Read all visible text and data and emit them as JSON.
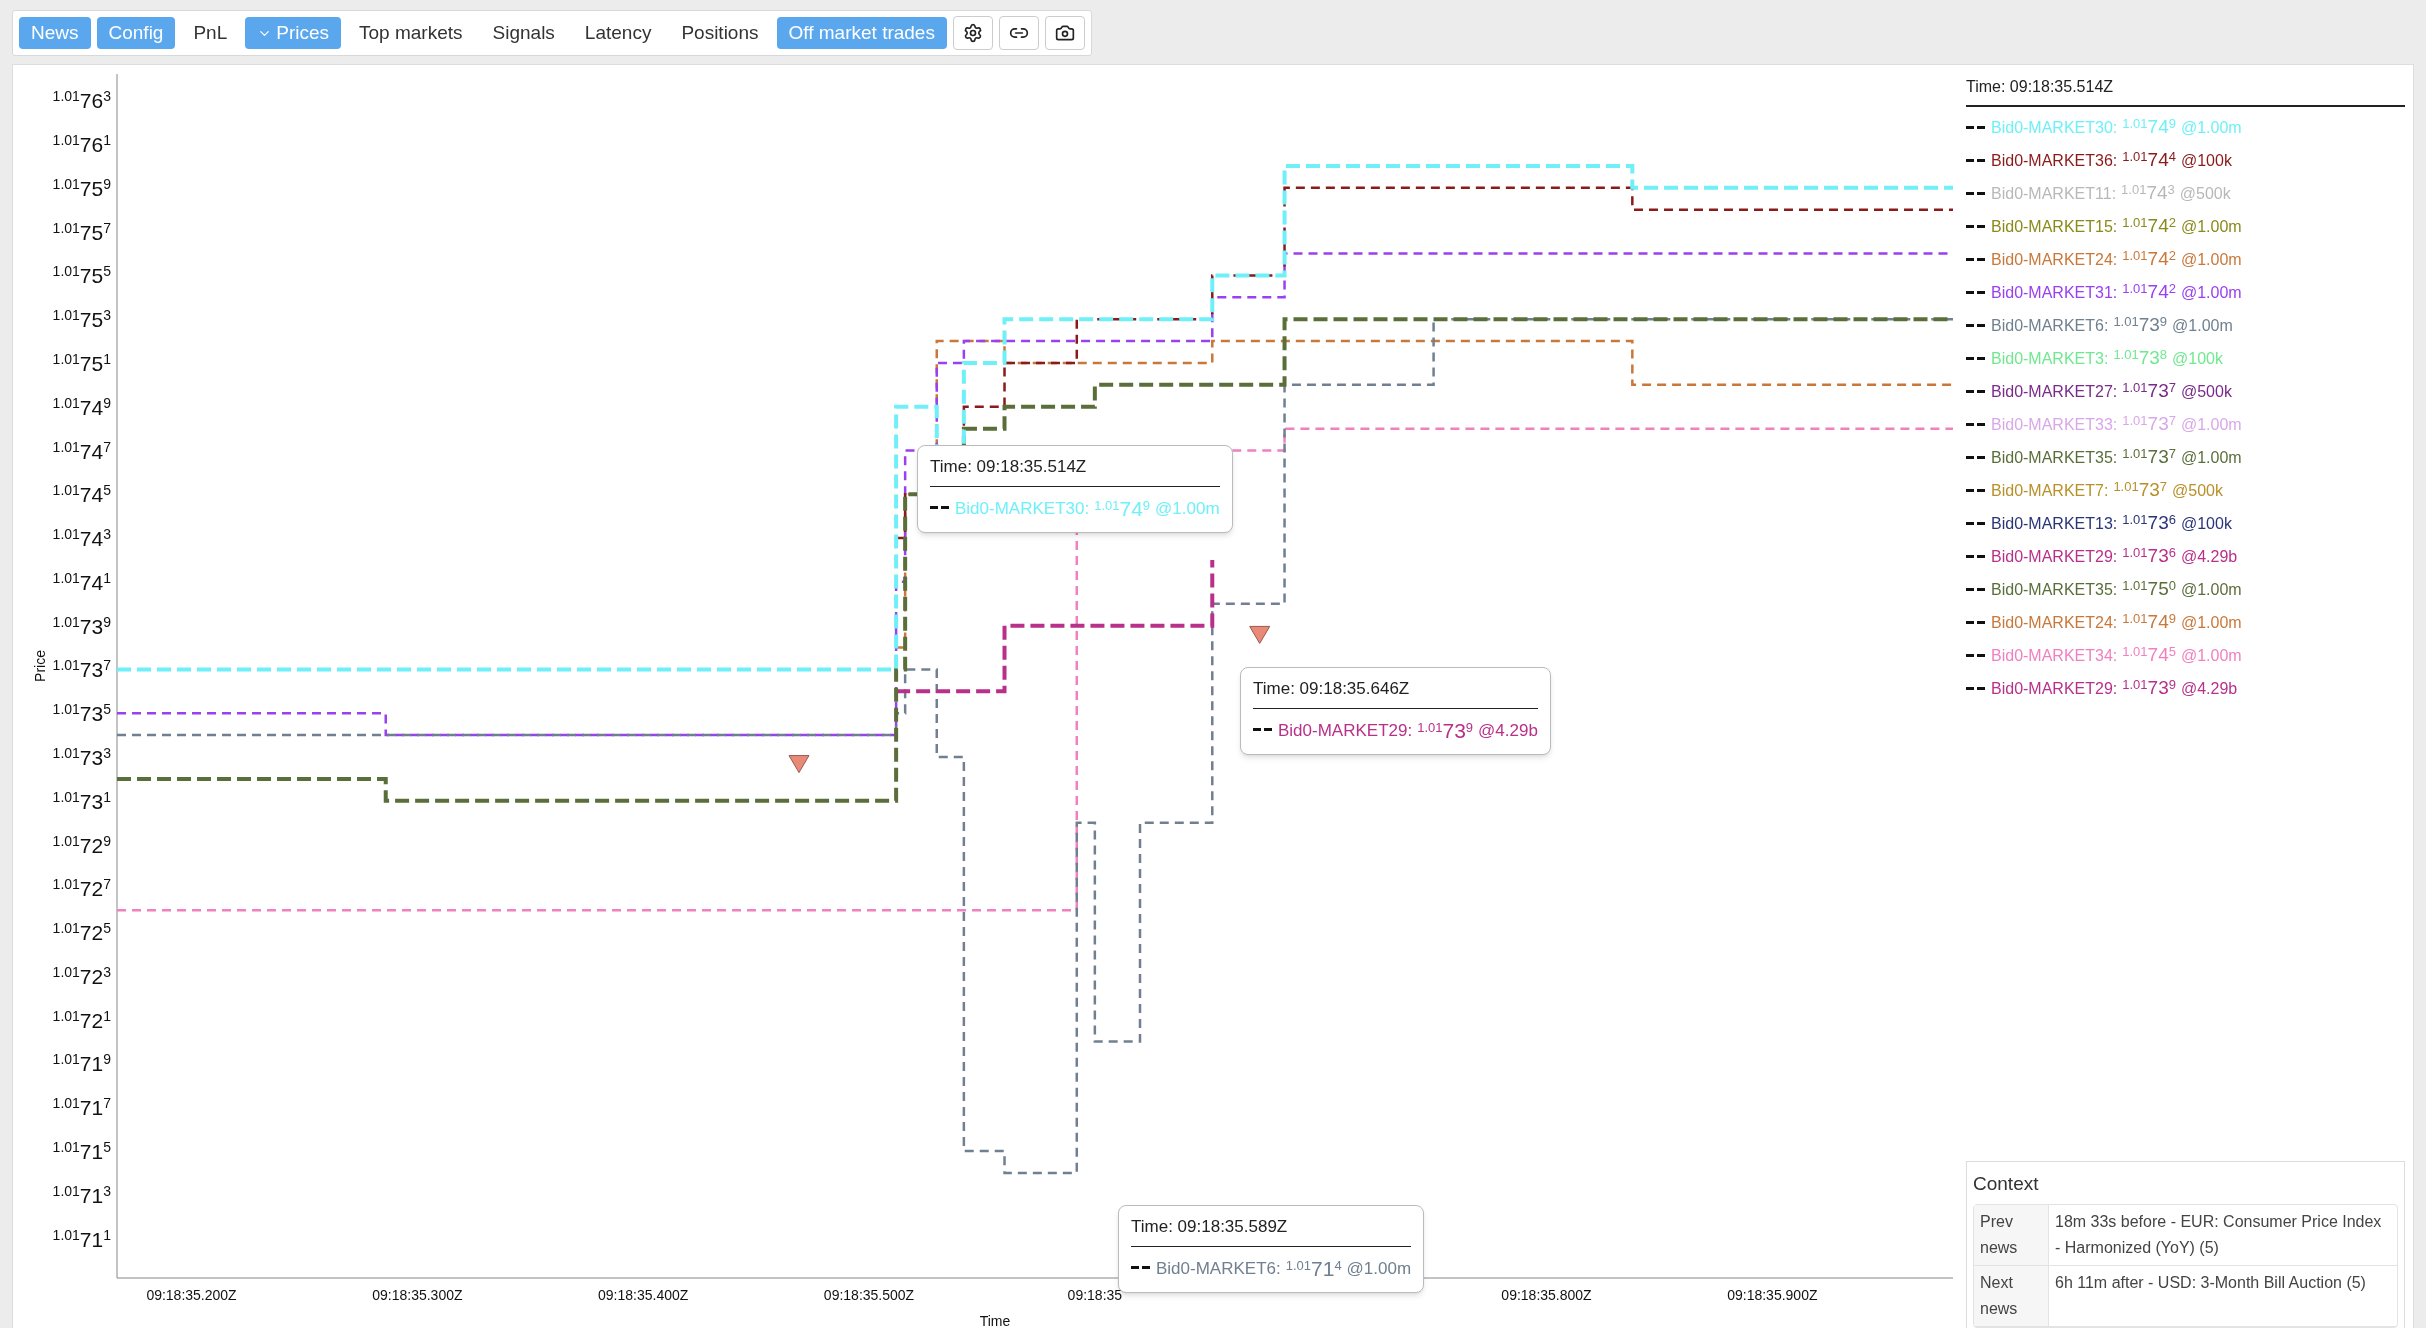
{
  "toolbar": {
    "tabs": [
      {
        "label": "News",
        "kind": "tab",
        "selected": true
      },
      {
        "label": "Config",
        "kind": "tab",
        "selected": true
      },
      {
        "label": "PnL",
        "kind": "tab",
        "selected": false
      },
      {
        "label": "Prices",
        "kind": "dropdown",
        "selected": true
      },
      {
        "label": "Top markets",
        "kind": "tab",
        "selected": false
      },
      {
        "label": "Signals",
        "kind": "tab",
        "selected": false
      },
      {
        "label": "Latency",
        "kind": "tab",
        "selected": false
      },
      {
        "label": "Positions",
        "kind": "tab",
        "selected": false
      },
      {
        "label": "Off market trades",
        "kind": "tab",
        "selected": true
      }
    ]
  },
  "chart": {
    "xlabel": "Time",
    "ylabel": "Price",
    "x_tick_labels": [
      "09:18:35.200Z",
      "09:18:35.300Z",
      "09:18:35.400Z",
      "09:18:35.500Z",
      "09:18:35",
      "09:18:35.800Z",
      "09:18:35.900Z"
    ],
    "y_tick_labels": [
      "$^{1.01}$76$^{3}$",
      "$^{1.01}$76$^{1}$",
      "$^{1.01}$75$^{9}$",
      "$^{1.01}$75$^{7}$",
      "$^{1.01}$75$^{5}$",
      "$^{1.01}$75$^{3}$",
      "$^{1.01}$75$^{1}$",
      "$^{1.01}$74$^{9}$",
      "$^{1.01}$74$^{7}$",
      "$^{1.01}$74$^{5}$",
      "$^{1.01}$74$^{3}$",
      "$^{1.01}$74$^{1}$",
      "$^{1.01}$73$^{9}$",
      "$^{1.01}$73$^{7}$",
      "$^{1.01}$73$^{5}$",
      "$^{1.01}$73$^{3}$",
      "$^{1.01}$73$^{1}$",
      "$^{1.01}$72$^{9}$",
      "$^{1.01}$72$^{7}$",
      "$^{1.01}$72$^{5}$",
      "$^{1.01}$72$^{3}$",
      "$^{1.01}$72$^{1}$",
      "$^{1.01}$71$^{9}$",
      "$^{1.01}$71$^{7}$",
      "$^{1.01}$71$^{5}$",
      "$^{1.01}$71$^{3}$",
      "$^{1.01}$71$^{1}$"
    ],
    "tooltips": [
      {
        "time": "Time: 09:18:35.514Z",
        "name": "Bid0-MARKET30:",
        "price": "$^{1.01}$74$^{9}$",
        "size": "@1.00m",
        "color": "#6ff0f8"
      },
      {
        "time": "Time: 09:18:35.646Z",
        "name": "Bid0-MARKET29:",
        "price": "$^{1.01}$73$^{9}$",
        "size": "@4.29b",
        "color": "#b8308a"
      },
      {
        "time": "Time: 09:18:35.589Z",
        "name": "Bid0-MARKET6:",
        "price": "$^{1.01}$71$^{4}$",
        "size": "@1.00m",
        "color": "#708090"
      }
    ]
  },
  "legend": {
    "time": "Time: 09:18:35.514Z",
    "entries": [
      {
        "name": "Bid0-MARKET30:",
        "price": "$^{1.01}$74$^{9}$",
        "size": "@1.00m",
        "color": "#6ff0f8"
      },
      {
        "name": "Bid0-MARKET36:",
        "price": "$^{1.01}$74$^{4}$",
        "size": "@100k",
        "color": "#8b1a1a"
      },
      {
        "name": "Bid0-MARKET11:",
        "price": "$^{1.01}$74$^{3}$",
        "size": "@500k",
        "color": "#b8b8b8"
      },
      {
        "name": "Bid0-MARKET15:",
        "price": "$^{1.01}$74$^{2}$",
        "size": "@1.00m",
        "color": "#8a8a1a"
      },
      {
        "name": "Bid0-MARKET24:",
        "price": "$^{1.01}$74$^{2}$",
        "size": "@1.00m",
        "color": "#c8783a"
      },
      {
        "name": "Bid0-MARKET31:",
        "price": "$^{1.01}$74$^{2}$",
        "size": "@1.00m",
        "color": "#9a40f0"
      },
      {
        "name": "Bid0-MARKET6:",
        "price": "$^{1.01}$73$^{9}$",
        "size": "@1.00m",
        "color": "#708090"
      },
      {
        "name": "Bid0-MARKET3:",
        "price": "$^{1.01}$73$^{8}$",
        "size": "@100k",
        "color": "#70e890"
      },
      {
        "name": "Bid0-MARKET27:",
        "price": "$^{1.01}$73$^{7}$",
        "size": "@500k",
        "color": "#7a2a8a"
      },
      {
        "name": "Bid0-MARKET33:",
        "price": "$^{1.01}$73$^{7}$",
        "size": "@1.00m",
        "color": "#d8a8e8"
      },
      {
        "name": "Bid0-MARKET35:",
        "price": "$^{1.01}$73$^{7}$",
        "size": "@1.00m",
        "color": "#5a6e3a"
      },
      {
        "name": "Bid0-MARKET7:",
        "price": "$^{1.01}$73$^{7}$",
        "size": "@500k",
        "color": "#b8902a"
      },
      {
        "name": "Bid0-MARKET13:",
        "price": "$^{1.01}$73$^{6}$",
        "size": "@100k",
        "color": "#2a3578"
      },
      {
        "name": "Bid0-MARKET29:",
        "price": "$^{1.01}$73$^{6}$",
        "size": "@4.29b",
        "color": "#b8308a"
      },
      {
        "name": "Bid0-MARKET35:",
        "price": "$^{1.01}$75$^{0}$",
        "size": "@1.00m",
        "color": "#5a6e3a"
      },
      {
        "name": "Bid0-MARKET24:",
        "price": "$^{1.01}$74$^{9}$",
        "size": "@1.00m",
        "color": "#c8783a"
      },
      {
        "name": "Bid0-MARKET34:",
        "price": "$^{1.01}$74$^{5}$",
        "size": "@1.00m",
        "color": "#f080c0"
      },
      {
        "name": "Bid0-MARKET29:",
        "price": "$^{1.01}$73$^{9}$",
        "size": "@4.29b",
        "color": "#b8308a"
      }
    ]
  },
  "context": {
    "title": "Context",
    "rows": [
      {
        "label": "Prev news",
        "value": "18m 33s before - EUR: Consumer Price Index - Harmonized (YoY) (5)"
      },
      {
        "label": "Next news",
        "value": "6h 11m after - USD: 3-Month Bill Auction (5)"
      }
    ]
  }
}
